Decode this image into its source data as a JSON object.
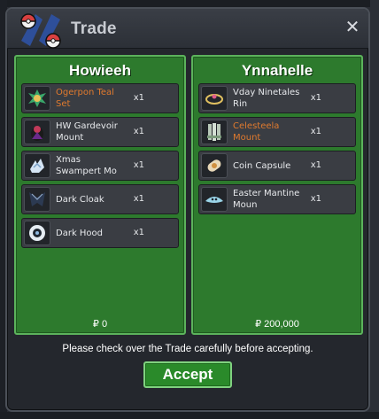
{
  "window": {
    "title": "Trade",
    "close_label": "✕"
  },
  "left": {
    "player": "Howieeh",
    "money": "₽ 0",
    "items": [
      {
        "name": "Ogerpon Teal Set",
        "qty": "x1",
        "rare": true,
        "icon": "ogerpon-teal-set-icon"
      },
      {
        "name": "HW Gardevoir Mount",
        "qty": "x1",
        "rare": false,
        "icon": "hw-gardevoir-mount-icon"
      },
      {
        "name": "Xmas Swampert Mo",
        "qty": "x1",
        "rare": false,
        "icon": "xmas-swampert-mount-icon"
      },
      {
        "name": "Dark Cloak",
        "qty": "x1",
        "rare": false,
        "icon": "dark-cloak-icon"
      },
      {
        "name": "Dark Hood",
        "qty": "x1",
        "rare": false,
        "icon": "dark-hood-icon"
      }
    ]
  },
  "right": {
    "player": "Ynnahelle",
    "money": "₽ 200,000",
    "items": [
      {
        "name": "Vday Ninetales Rin",
        "qty": "x1",
        "rare": false,
        "icon": "vday-ninetales-ring-icon"
      },
      {
        "name": "Celesteela Mount",
        "qty": "x1",
        "rare": true,
        "icon": "celesteela-mount-icon"
      },
      {
        "name": "Coin Capsule",
        "qty": "x1",
        "rare": false,
        "icon": "coin-capsule-icon"
      },
      {
        "name": "Easter Mantine Moun",
        "qty": "x1",
        "rare": false,
        "icon": "easter-mantine-mount-icon"
      }
    ]
  },
  "notice": "Please check over the Trade carefully before accepting.",
  "accept_label": "Accept",
  "colors": {
    "panel_green": "#2d7a2d",
    "rare_item": "#e07a2e",
    "accept_green": "#2a8a2a"
  }
}
